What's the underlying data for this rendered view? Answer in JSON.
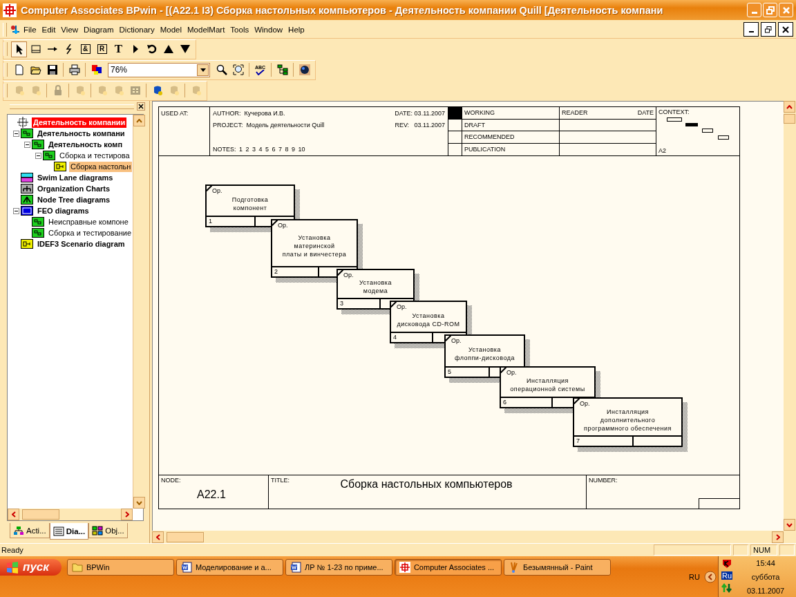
{
  "window": {
    "title": "Computer Associates BPwin - [(A22.1 I3) Сборка настольных компьютеров - Деятельность компании Quill  [Деятельность компани"
  },
  "menu": [
    "File",
    "Edit",
    "View",
    "Diagram",
    "Dictionary",
    "Model",
    "ModelMart",
    "Tools",
    "Window",
    "Help"
  ],
  "toolbars": [
    [
      {
        "kind": "pointer",
        "selected": true
      },
      {
        "kind": "box",
        "selected": false
      },
      {
        "kind": "arrow",
        "selected": false
      },
      {
        "kind": "squiggle",
        "selected": false
      },
      {
        "kind": "glyphbox",
        "glyph": "&",
        "selected": false
      },
      {
        "kind": "glyphbox",
        "glyph": "R",
        "selected": false
      },
      {
        "kind": "glyph",
        "glyph": "T",
        "selected": false
      },
      {
        "kind": "play",
        "selected": false
      },
      {
        "kind": "undo",
        "selected": false
      },
      {
        "kind": "up",
        "selected": false
      },
      {
        "kind": "down",
        "selected": false
      }
    ],
    [
      {
        "kind": "new"
      },
      {
        "kind": "open"
      },
      {
        "kind": "save"
      },
      {
        "kind": "sep"
      },
      {
        "kind": "print"
      },
      {
        "kind": "sep"
      },
      {
        "kind": "colors"
      },
      {
        "kind": "zoom",
        "value": "76%"
      },
      {
        "kind": "zoomin"
      },
      {
        "kind": "zoomfit"
      },
      {
        "kind": "sep"
      },
      {
        "kind": "spell",
        "glyph": "ABC"
      },
      {
        "kind": "sep"
      },
      {
        "kind": "tree"
      },
      {
        "kind": "sep"
      },
      {
        "kind": "globe"
      }
    ],
    [
      {
        "kind": "blob",
        "disabled": true
      },
      {
        "kind": "blob",
        "disabled": true
      },
      {
        "kind": "sep"
      },
      {
        "kind": "lock",
        "disabled": true
      },
      {
        "kind": "sep"
      },
      {
        "kind": "blob",
        "disabled": true
      },
      {
        "kind": "sep"
      },
      {
        "kind": "blob",
        "disabled": true
      },
      {
        "kind": "blob",
        "disabled": true
      },
      {
        "kind": "grid",
        "disabled": true
      },
      {
        "kind": "sep"
      },
      {
        "kind": "blob",
        "disabled": false
      },
      {
        "kind": "blob",
        "disabled": true
      },
      {
        "kind": "sep"
      },
      {
        "kind": "blob",
        "disabled": true
      }
    ]
  ],
  "tree": [
    {
      "label": "Деятельность компании",
      "kind": "model",
      "bold": true,
      "selected": false,
      "children": [
        {
          "label": "Деятельность компани",
          "kind": "idef0",
          "bold": true,
          "selected": false,
          "expanded": true,
          "children": [
            {
              "label": "Деятельность комп",
              "kind": "idef0",
              "bold": true,
              "selected": false,
              "expanded": true,
              "children": [
                {
                  "label": "Сборка и тестирова",
                  "kind": "idef0",
                  "bold": false,
                  "selected": false,
                  "expanded": true,
                  "children": [
                    {
                      "label": "Сборка настольн",
                      "kind": "idef3",
                      "bold": false,
                      "selected": true
                    }
                  ]
                }
              ]
            }
          ]
        },
        {
          "label": "Swim Lane diagrams",
          "kind": "swimlane",
          "bold": true,
          "selected": false
        },
        {
          "label": "Organization Charts",
          "kind": "orgchart",
          "bold": true,
          "selected": false
        },
        {
          "label": "Node Tree diagrams",
          "kind": "nodetree",
          "bold": true,
          "selected": false
        },
        {
          "label": "FEO diagrams",
          "kind": "feo",
          "bold": true,
          "selected": false,
          "expanded": true,
          "children": [
            {
              "label": "Неисправные компоне",
              "kind": "idef0",
              "bold": false,
              "selected": false
            },
            {
              "label": "Сборка и тестирование",
              "kind": "idef0",
              "bold": false,
              "selected": false
            }
          ]
        },
        {
          "label": "IDEF3 Scenario diagram",
          "kind": "idef3",
          "bold": true,
          "selected": false
        }
      ]
    }
  ],
  "panel_tabs": [
    {
      "label": "Acti...",
      "kind": "activity",
      "selected": false
    },
    {
      "label": "Dia...",
      "kind": "diagram",
      "selected": true
    },
    {
      "label": "Obj...",
      "kind": "object",
      "selected": false
    }
  ],
  "header": {
    "used_at_label": "USED AT:",
    "author_label": "AUTHOR:",
    "author": "Кучерова И.В.",
    "date_label": "DATE:",
    "date": "03.11.2007",
    "project_label": "PROJECT:",
    "project": "Модель деятельности Quill",
    "rev_label": "REV:",
    "rev": "03.11.2007",
    "notes_label": "NOTES:",
    "notes": "1 2 3 4 5 6 7 8 9 10",
    "statuses": [
      {
        "label": "WORKING",
        "selected": true
      },
      {
        "label": "DRAFT",
        "selected": false
      },
      {
        "label": "RECOMMENDED",
        "selected": false
      },
      {
        "label": "PUBLICATION",
        "selected": false
      }
    ],
    "reader_label": "READER",
    "reader_date_label": "DATE",
    "context_label": "CONTEXT:",
    "context_node": "A2"
  },
  "boxes": [
    {
      "text": "Подготовка\nкомпонент",
      "number": "1",
      "tag": "Ор."
    },
    {
      "text": "Установка\nматеринской\nплаты и винчестера",
      "number": "2",
      "tag": "Ор."
    },
    {
      "text": "Установка\nмодема",
      "number": "3",
      "tag": "Ор."
    },
    {
      "text": "Установка\nдисковода CD-ROM",
      "number": "4",
      "tag": "Ор."
    },
    {
      "text": "Установка\nфлоппи-дисковода",
      "number": "5",
      "tag": "Ор."
    },
    {
      "text": "Инсталляция\nоперационной системы",
      "number": "6",
      "tag": "Ор."
    },
    {
      "text": "Инсталляция\nдополнительного\nпрограммного обеспечения",
      "number": "7",
      "tag": "Ор."
    }
  ],
  "footer": {
    "node_label": "NODE:",
    "node": "A22.1",
    "title_label": "TITLE:",
    "title": "Сборка настольных компьютеров",
    "number_label": "NUMBER:"
  },
  "status_bar": {
    "message": "Ready",
    "indicator": "NUM"
  },
  "taskbar": {
    "start": "пуск",
    "tasks": [
      {
        "label": "BPWin",
        "kind": "folder",
        "selected": false
      },
      {
        "label": "Моделирование и а...",
        "kind": "word",
        "selected": false
      },
      {
        "label": "ЛР № 1-23 по приме...",
        "kind": "word",
        "selected": false
      },
      {
        "label": "Computer Associates ...",
        "kind": "bpwin",
        "selected": true
      },
      {
        "label": "Безымянный - Paint",
        "kind": "paint",
        "selected": false
      }
    ],
    "language": "RU",
    "tray_language": "Ru",
    "time": "15:44",
    "weekday": "суббота",
    "date": "03.11.2007"
  }
}
